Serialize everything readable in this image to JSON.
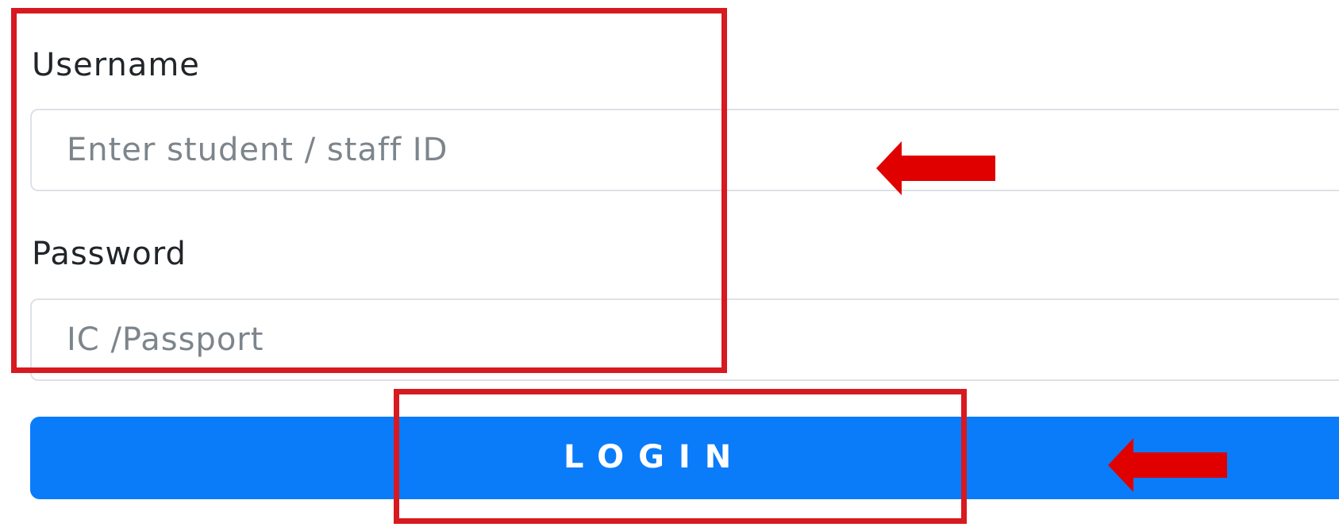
{
  "form": {
    "username_label": "Username",
    "username_placeholder": "Enter student / staff ID",
    "password_label": "Password",
    "password_placeholder": "IC /Passport",
    "login_label": "LOGIN"
  },
  "colors": {
    "button_bg": "#0a7cf9",
    "highlight": "#d71920",
    "arrow": "#e00000"
  },
  "annotations": {
    "arrow_icon": "left-arrow-icon",
    "highlight_icon": "highlight-rectangle"
  }
}
